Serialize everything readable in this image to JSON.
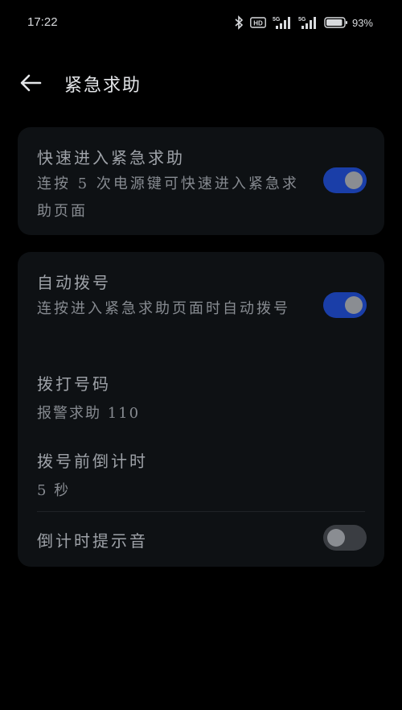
{
  "status_bar": {
    "time": "17:22",
    "network_1": "5G",
    "network_2": "5G",
    "hd_label": "HD",
    "battery_percent": "93%",
    "battery_level": 0.93,
    "icons": [
      "bluetooth-icon",
      "hd-voice-icon",
      "signal-5g-icon",
      "signal-5g-icon",
      "battery-icon"
    ]
  },
  "header": {
    "back_icon": "arrow-left-icon",
    "title": "紧急求助"
  },
  "quick_entry": {
    "title": "快速进入紧急求助",
    "subtitle": "连按 5 次电源键可快速进入紧急求助页面",
    "enabled": true
  },
  "auto_dial": {
    "title": "自动拨号",
    "subtitle": "连按进入紧急求助页面时自动拨号",
    "enabled": true
  },
  "dial_number": {
    "title": "拨打号码",
    "value": "报警求助 110"
  },
  "countdown": {
    "title": "拨号前倒计时",
    "value": "5 秒"
  },
  "countdown_sound": {
    "title": "倒计时提示音",
    "enabled": false
  },
  "colors": {
    "background": "#000000",
    "card": "#0e1114",
    "toggle_on": "#1a3ea8",
    "toggle_off": "#3a3d42"
  }
}
